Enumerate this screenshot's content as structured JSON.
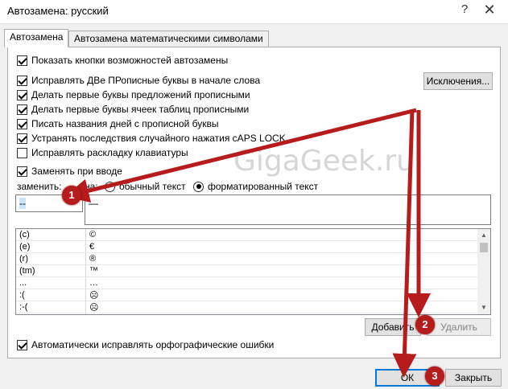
{
  "window": {
    "title": "Автозамена: русский",
    "help_glyph": "?",
    "close_glyph": "✕"
  },
  "tabs": [
    {
      "label": "Автозамена",
      "active": true
    },
    {
      "label": "Автозамена математическими символами",
      "active": false
    }
  ],
  "options": {
    "show_buttons": {
      "label": "Показать кнопки возможностей автозамены",
      "checked": true
    },
    "two_initials": {
      "label": "Исправлять ДВе ПРописные буквы в начале слова",
      "checked": true
    },
    "first_sentence": {
      "label": "Делать первые буквы предложений прописными",
      "checked": true
    },
    "first_cells": {
      "label": "Делать первые буквы ячеек таблиц прописными",
      "checked": true
    },
    "day_names": {
      "label": "Писать названия дней с прописной буквы",
      "checked": true
    },
    "caps_lock": {
      "label": "Устранять последствия случайного нажатия cAPS LOCK",
      "checked": true
    },
    "keyboard_layout": {
      "label": "Исправлять раскладку клавиатуры",
      "checked": false
    },
    "replace_typing": {
      "label": "Заменять при вводе",
      "checked": true
    },
    "spelling": {
      "label": "Автоматически исправлять орфографические ошибки",
      "checked": true
    }
  },
  "exceptions_button": "Исключения...",
  "replace": {
    "replace_label": "заменить:",
    "with_label": "на:",
    "plain_text": "обычный текст",
    "formatted_text": "форматированный текст",
    "formatted_selected": true,
    "replace_value": "--",
    "with_value": "—"
  },
  "entries": [
    {
      "from": "(c)",
      "to": "©"
    },
    {
      "from": "(e)",
      "to": "€"
    },
    {
      "from": "(r)",
      "to": "®"
    },
    {
      "from": "(tm)",
      "to": "™"
    },
    {
      "from": "...",
      "to": "…"
    },
    {
      "from": ":(",
      "to": "☹"
    },
    {
      "from": ":-(",
      "to": "☹"
    }
  ],
  "buttons": {
    "add": "Добавить",
    "delete": "Удалить",
    "ok": "ОК",
    "close": "Закрыть"
  },
  "watermark": "GigaGeek.ru",
  "badges": [
    "1",
    "2",
    "3"
  ],
  "colors": {
    "accent": "#0078d7",
    "annotation": "#b71c1c"
  }
}
